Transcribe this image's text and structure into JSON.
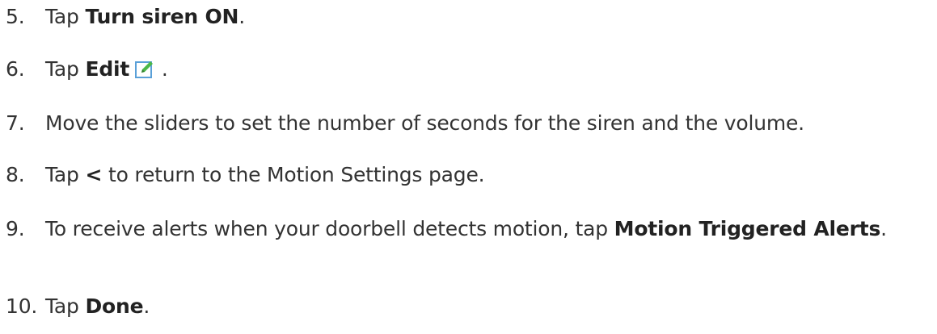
{
  "steps": [
    {
      "number": "5.",
      "text_before": "Tap ",
      "bold": "Turn siren ON",
      "text_after": "."
    },
    {
      "number": "6.",
      "text_before": "Tap ",
      "bold": "Edit",
      "icon": "edit-pencil-icon",
      "text_after": "."
    },
    {
      "number": "7.",
      "text": "Move the sliders to set the number of seconds for the siren and the volume."
    },
    {
      "number": "8.",
      "text_before": "Tap ",
      "bold": "<",
      "text_after": " to return to the Motion Settings page."
    },
    {
      "number": "9.",
      "text_before": "To receive alerts when your doorbell detects motion, tap ",
      "bold": "Motion Triggered Alerts",
      "text_after": "."
    },
    {
      "number": "10.",
      "text_before": "Tap ",
      "bold": "Done",
      "text_after": "."
    }
  ],
  "colors": {
    "text": "#333333",
    "icon_green": "#4db848",
    "icon_border": "#5aa0d8"
  }
}
